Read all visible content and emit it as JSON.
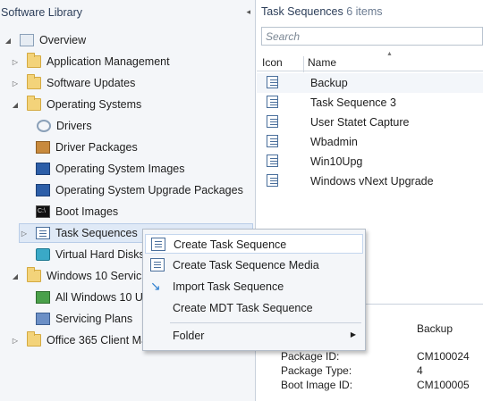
{
  "left_pane": {
    "title": "Software Library",
    "collapse_glyph": "◂",
    "tree": [
      {
        "label": "Overview",
        "icon": "overview-icon",
        "expander": "◢"
      },
      {
        "label": "Application Management",
        "icon": "folder-icon",
        "expander": "▷"
      },
      {
        "label": "Software Updates",
        "icon": "folder-icon",
        "expander": "▷"
      },
      {
        "label": "Operating Systems",
        "icon": "folder-icon",
        "expander": "◢"
      },
      {
        "label": "Drivers",
        "icon": "gear-icon"
      },
      {
        "label": "Driver Packages",
        "icon": "package-icon"
      },
      {
        "label": "Operating System Images",
        "icon": "monitor-icon"
      },
      {
        "label": "Operating System Upgrade Packages",
        "icon": "upgrade-monitor-icon"
      },
      {
        "label": "Boot Images",
        "icon": "console-icon",
        "console_text": "C:\\"
      },
      {
        "label": "Task Sequences",
        "icon": "task-sequence-icon",
        "expander": "▷"
      },
      {
        "label": "Virtual Hard Disks",
        "icon": "disk-icon"
      },
      {
        "label": "Windows 10 Servicing",
        "icon": "folder-icon",
        "expander": "◢"
      },
      {
        "label": "All Windows 10 Updates",
        "icon": "update-icon"
      },
      {
        "label": "Servicing Plans",
        "icon": "plan-icon"
      },
      {
        "label": "Office 365 Client Management",
        "icon": "folder-icon",
        "expander": "▷"
      }
    ]
  },
  "right_pane": {
    "title": "Task Sequences",
    "count": "6 items",
    "search_placeholder": "Search",
    "columns": {
      "icon": "Icon",
      "name": "Name",
      "sort_glyph": "▲"
    },
    "items": [
      "Backup",
      "Task Sequence 3",
      "User Statet Capture",
      "Wbadmin",
      "Win10Upg",
      "Windows vNext Upgrade"
    ]
  },
  "details": {
    "name_value": "Backup",
    "rows": [
      {
        "label": "Package ID:",
        "value": "CM100024"
      },
      {
        "label": "Package Type:",
        "value": "4"
      },
      {
        "label": "Boot Image ID:",
        "value": "CM100005"
      }
    ]
  },
  "context_menu": {
    "items": [
      {
        "label": "Create Task Sequence",
        "icon": "create-task-sequence-icon"
      },
      {
        "label": "Create Task Sequence Media",
        "icon": "task-sequence-media-icon"
      },
      {
        "label": "Import Task Sequence",
        "icon": "import-icon"
      },
      {
        "label": "Create MDT Task Sequence",
        "icon": ""
      },
      {
        "label": "Folder",
        "icon": "",
        "submenu_glyph": "▶"
      }
    ],
    "import_glyph": "↘"
  },
  "colors": {
    "accent": "#2c3e59",
    "selection": "#dfe9f6",
    "hover_border": "#c4d6ee"
  }
}
